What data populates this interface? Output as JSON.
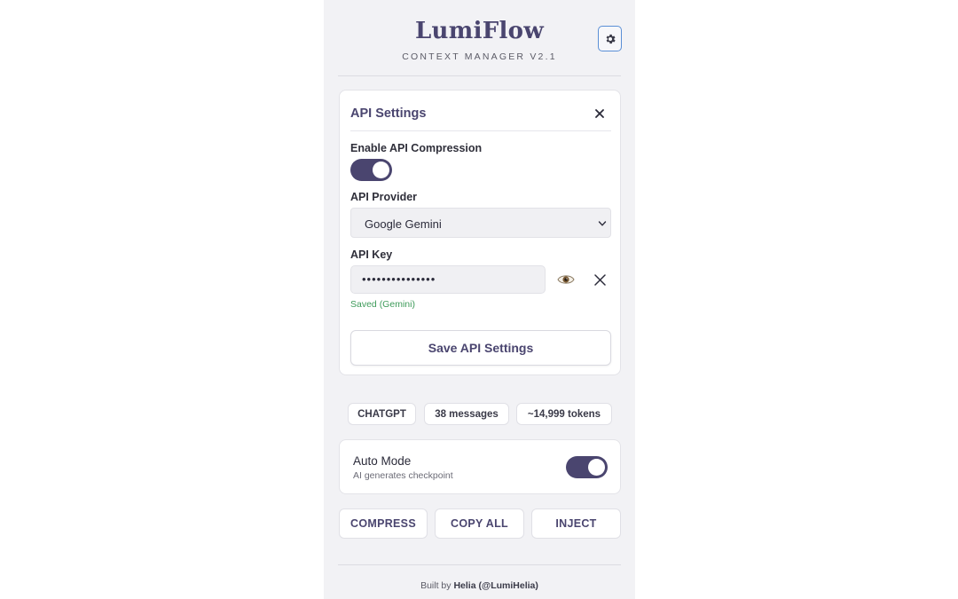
{
  "app": {
    "title": "LumiFlow",
    "subtitle": "CONTEXT MANAGER V2.1",
    "settings_icon": "gear-icon"
  },
  "api_settings": {
    "title": "API Settings",
    "close_icon": "close-icon",
    "compression_label": "Enable API Compression",
    "compression_enabled": true,
    "provider_label": "API Provider",
    "provider_value": "Google Gemini",
    "key_label": "API Key",
    "key_value": "•••••••••••••••",
    "show_key_icon": "eye-icon",
    "clear_key_icon": "clear-icon",
    "status": "Saved (Gemini)",
    "save_label": "Save API Settings"
  },
  "stats": {
    "platform": "CHATGPT",
    "messages": "38 messages",
    "tokens": "~14,999 tokens"
  },
  "auto_mode": {
    "title": "Auto Mode",
    "description": "AI generates checkpoint",
    "enabled": true
  },
  "actions": {
    "compress": "COMPRESS",
    "copy_all": "COPY ALL",
    "inject": "INJECT"
  },
  "footer": {
    "prefix": "Built by",
    "author": "Helia (@LumiHelia)"
  },
  "colors": {
    "accent": "#4a456f",
    "success": "#3e9b5a",
    "focus_border": "#5a8fd6"
  }
}
